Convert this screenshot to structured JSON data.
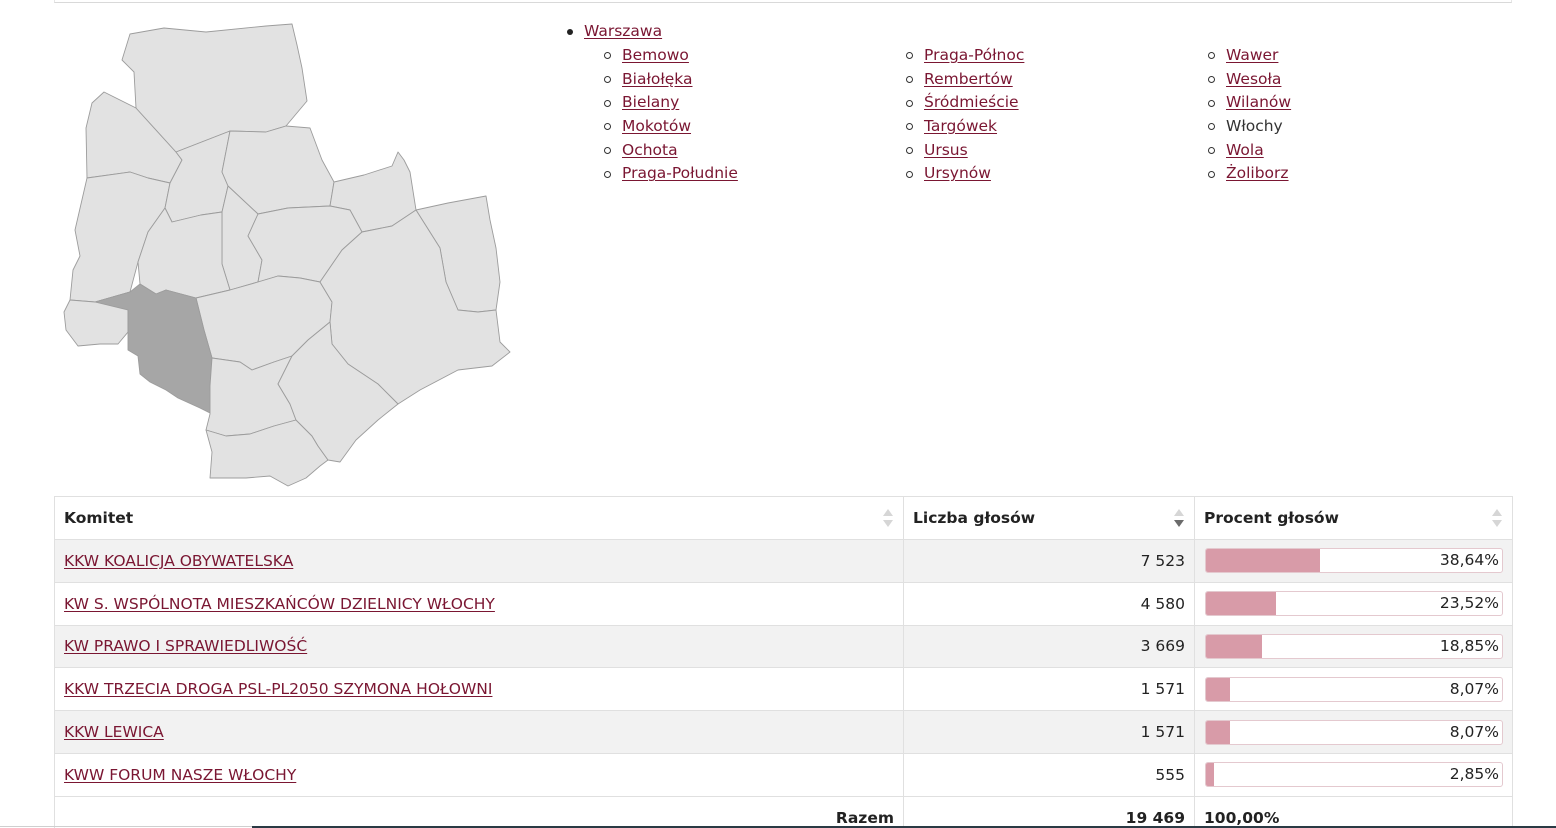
{
  "nav": {
    "root": "Warszawa",
    "columns": [
      [
        {
          "label": "Bemowo",
          "link": true
        },
        {
          "label": "Białołęka",
          "link": true
        },
        {
          "label": "Bielany",
          "link": true
        },
        {
          "label": "Mokotów",
          "link": true
        },
        {
          "label": "Ochota",
          "link": true
        },
        {
          "label": "Praga-Południe",
          "link": true
        }
      ],
      [
        {
          "label": "Praga-Północ",
          "link": true
        },
        {
          "label": "Rembertów",
          "link": true
        },
        {
          "label": "Śródmieście",
          "link": true
        },
        {
          "label": "Targówek",
          "link": true
        },
        {
          "label": "Ursus",
          "link": true
        },
        {
          "label": "Ursynów",
          "link": true
        }
      ],
      [
        {
          "label": "Wawer",
          "link": true
        },
        {
          "label": "Wesoła",
          "link": true
        },
        {
          "label": "Wilanów",
          "link": true
        },
        {
          "label": "Włochy",
          "link": false
        },
        {
          "label": "Wola",
          "link": true
        },
        {
          "label": "Żoliborz",
          "link": true
        }
      ]
    ]
  },
  "table": {
    "headers": {
      "committee": "Komitet",
      "votes": "Liczba głosów",
      "percent": "Procent głosów"
    },
    "sorted_column": "votes",
    "sort_direction": "descending",
    "rows": [
      {
        "committee": "KKW KOALICJA OBYWATELSKA",
        "votes": "7 523",
        "percent": "38,64%",
        "share": 38.64
      },
      {
        "committee": "KW S. WSPÓLNOTA MIESZKAŃCÓW DZIELNICY WŁOCHY",
        "votes": "4 580",
        "percent": "23,52%",
        "share": 23.52
      },
      {
        "committee": "KW PRAWO I SPRAWIEDLIWOŚĆ",
        "votes": "3 669",
        "percent": "18,85%",
        "share": 18.85
      },
      {
        "committee": "KKW TRZECIA DROGA PSL-PL2050 SZYMONA HOŁOWNI",
        "votes": "1 571",
        "percent": "8,07%",
        "share": 8.07
      },
      {
        "committee": "KKW LEWICA",
        "votes": "1 571",
        "percent": "8,07%",
        "share": 8.07
      },
      {
        "committee": "KWW FORUM NASZE WŁOCHY",
        "votes": "555",
        "percent": "2,85%",
        "share": 2.85
      }
    ],
    "total": {
      "label": "Razem",
      "votes": "19 469",
      "percent": "100,00%"
    }
  },
  "map": {
    "selected_district": "Włochy",
    "colors": {
      "district": "#e2e2e2",
      "selected": "#a6a6a6",
      "border": "#9c9c9c"
    }
  },
  "colors": {
    "link": "#7a1632",
    "bar_fill": "#d89ba8",
    "row_alt": "#f2f2f2"
  }
}
